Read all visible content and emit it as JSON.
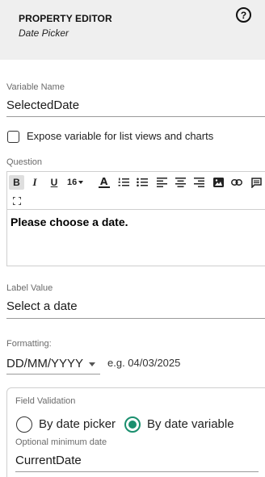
{
  "header": {
    "title": "PROPERTY EDITOR",
    "subtitle": "Date Picker",
    "help_icon": "question-circle-icon"
  },
  "variable_name": {
    "label": "Variable Name",
    "value": "SelectedDate"
  },
  "expose_checkbox": {
    "label": "Expose variable for list views and charts",
    "checked": false
  },
  "question": {
    "label": "Question",
    "toolbar": {
      "bold": "B",
      "italic": "I",
      "underline": "U",
      "font_size": "16",
      "icons": [
        "font-color-icon",
        "ordered-list-icon",
        "bullet-list-icon",
        "align-left-icon",
        "align-center-icon",
        "align-right-icon",
        "image-icon",
        "link-icon",
        "comment-icon",
        "fullscreen-icon"
      ]
    },
    "content": "Please choose a date."
  },
  "label_value": {
    "label": "Label Value",
    "value": "Select a date"
  },
  "formatting": {
    "label": "Formatting:",
    "selected": "DD/MM/YYYY",
    "example": "e.g. 04/03/2025"
  },
  "field_validation": {
    "title": "Field Validation",
    "options": [
      {
        "label": "By date picker",
        "selected": false
      },
      {
        "label": "By date variable",
        "selected": true
      }
    ],
    "min_date_label": "Optional minimum date",
    "min_date_value": "CurrentDate"
  },
  "colors": {
    "header_bg": "#efefef",
    "accent": "#1a8f6e"
  }
}
